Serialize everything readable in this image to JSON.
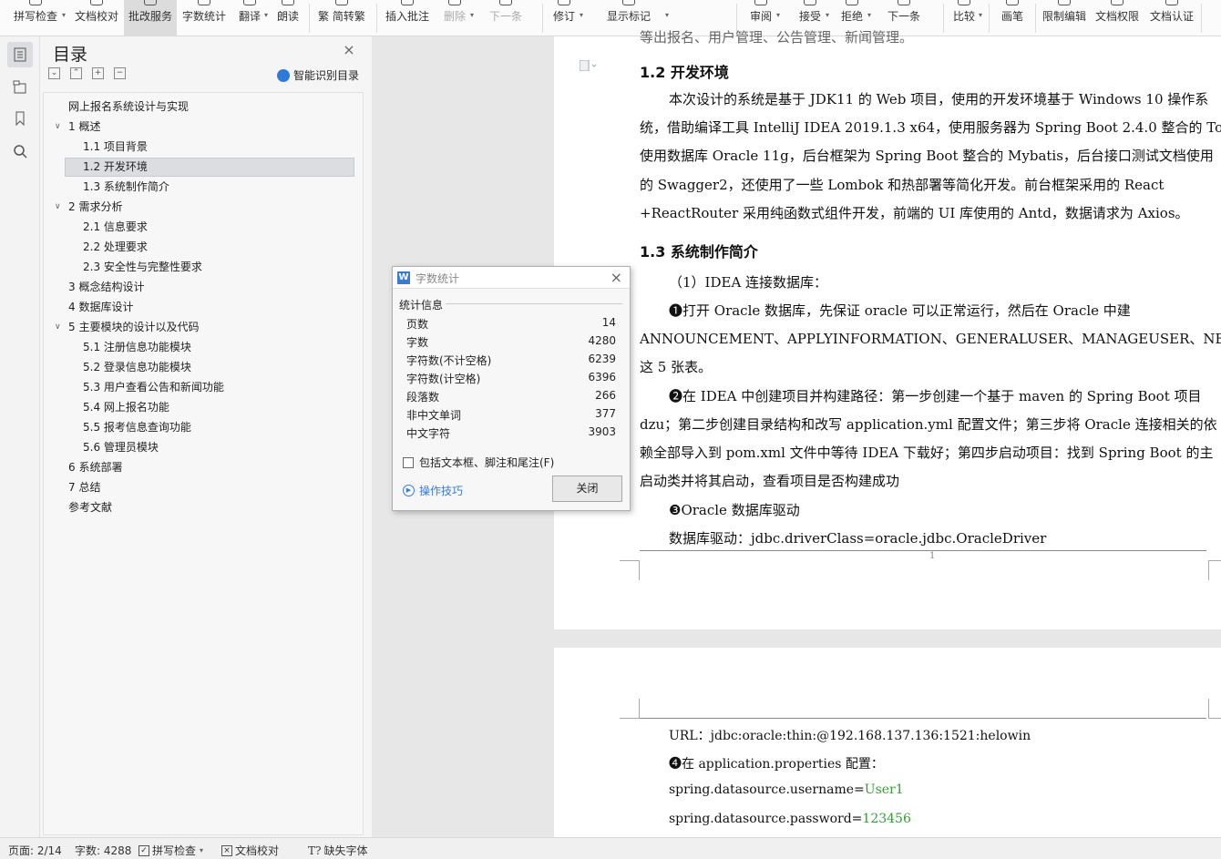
{
  "ribbon": {
    "items": [
      {
        "label": "拼写检查",
        "dropdown": true
      },
      {
        "label": "文档校对",
        "dropdown": false
      },
      {
        "label": "批改服务",
        "dropdown": false
      },
      {
        "label": "字数统计",
        "dropdown": false
      },
      {
        "label": "翻译",
        "dropdown": true
      },
      {
        "label": "朗读",
        "dropdown": false
      },
      {
        "label": "繁 简转繁",
        "dropdown": false
      },
      {
        "label": "插入批注",
        "dropdown": false
      },
      {
        "label": "删除",
        "dropdown": true
      },
      {
        "label": "下一条",
        "dropdown": false
      },
      {
        "label": "修订",
        "dropdown": true
      },
      {
        "label": "显示标记",
        "dropdown": true
      },
      {
        "label": "审阅",
        "dropdown": true
      },
      {
        "label": "接受",
        "dropdown": true
      },
      {
        "label": "拒绝",
        "dropdown": true
      },
      {
        "label": "下一条",
        "dropdown": false
      },
      {
        "label": "比较",
        "dropdown": true
      },
      {
        "label": "画笔",
        "dropdown": false
      },
      {
        "label": "限制编辑",
        "dropdown": false
      },
      {
        "label": "文档权限",
        "dropdown": false
      },
      {
        "label": "文档认证",
        "dropdown": false
      }
    ]
  },
  "toc": {
    "title": "目录",
    "smart_label": "智能识别目录",
    "items": [
      {
        "text": "网上报名系统设计与实现",
        "level": 0,
        "arrow": ""
      },
      {
        "text": "1  概述",
        "level": 1,
        "arrow": "v"
      },
      {
        "text": "1.1  项目背景",
        "level": 2,
        "arrow": ""
      },
      {
        "text": "1.2  开发环境",
        "level": 2,
        "arrow": "",
        "active": true
      },
      {
        "text": "1.3  系统制作简介",
        "level": 2,
        "arrow": ""
      },
      {
        "text": "2  需求分析",
        "level": 1,
        "arrow": "v"
      },
      {
        "text": "2.1  信息要求",
        "level": 2,
        "arrow": ""
      },
      {
        "text": "2.2  处理要求",
        "level": 2,
        "arrow": ""
      },
      {
        "text": "2.3  安全性与完整性要求",
        "level": 2,
        "arrow": ""
      },
      {
        "text": "3  概念结构设计",
        "level": 1,
        "arrow": ""
      },
      {
        "text": "4  数据库设计",
        "level": 1,
        "arrow": ""
      },
      {
        "text": "5  主要模块的设计以及代码",
        "level": 1,
        "arrow": "v"
      },
      {
        "text": "5.1  注册信息功能模块",
        "level": 2,
        "arrow": ""
      },
      {
        "text": "5.2  登录信息功能模块",
        "level": 2,
        "arrow": ""
      },
      {
        "text": "5.3  用户查看公告和新闻功能",
        "level": 2,
        "arrow": ""
      },
      {
        "text": "5.4  网上报名功能",
        "level": 2,
        "arrow": ""
      },
      {
        "text": "5.5  报考信息查询功能",
        "level": 2,
        "arrow": ""
      },
      {
        "text": "5.6  管理员模块",
        "level": 2,
        "arrow": ""
      },
      {
        "text": "6  系统部署",
        "level": 1,
        "arrow": ""
      },
      {
        "text": "7  总结",
        "level": 1,
        "arrow": ""
      },
      {
        "text": "参考文献",
        "level": 0,
        "arrow": ""
      }
    ]
  },
  "document": {
    "top_partial": "等出报名、用户管理、公告管理、新闻管理。",
    "h12": "1.2  开发环境",
    "p_env": [
      "本次设计的系统是基于 JDK11 的 Web 项目，使用的开发环境基于 Windows 10 操作系",
      "统，借助编译工具 IntelliJ IDEA 2019.1.3 x64，使用服务器为 Spring Boot 2.4.0 整合的 Tomcat，",
      "使用数据库 Oracle 11g，后台框架为 Spring Boot 整合的 Mybatis，后台接口测试文档使用",
      "的 Swagger2，还使用了一些 Lombok 和热部署等简化开发。前台框架采用的 React",
      "+ReactRouter 采用纯函数式组件开发，前端的 UI 库使用的 Antd，数据请求为 Axios。"
    ],
    "h13": "1.3  系统制作简介",
    "p_intro": [
      "（1）IDEA 连接数据库：",
      "❶打开 Oracle 数据库，先保证 oracle 可以正常运行，然后在 Oracle 中建",
      "ANNOUNCEMENT、APPLYINFORMATION、GENERALUSER、MANAGEUSER、NEWS",
      "这 5 张表。",
      "❷在 IDEA 中创建项目并构建路径：第一步创建一个基于 maven 的 Spring Boot 项目",
      "dzu；第二步创建目录结构和改写 application.yml 配置文件；第三步将 Oracle 连接相关的依",
      "赖全部导入到 pom.xml 文件中等待 IDEA 下载好；第四步启动项目：找到 Spring Boot 的主",
      "启动类并将其启动，查看项目是否构建成功",
      "❸Oracle 数据库驱动",
      "数据库驱动：jdbc.driverClass=oracle.jdbc.OracleDriver"
    ],
    "page_number": "1",
    "p2": {
      "url": "URL：jdbc:oracle:thin:@192.168.137.136:1521:helowin",
      "cfg": "❹在 application.properties 配置：",
      "user_key": "spring.datasource.username=",
      "user_val": "User1",
      "pass_key": "spring.datasource.password=",
      "pass_val": "123456"
    }
  },
  "dialog": {
    "title": "字数统计",
    "section": "统计信息",
    "stats": [
      {
        "label": "页数",
        "value": "14"
      },
      {
        "label": "字数",
        "value": "4280"
      },
      {
        "label": "字符数(不计空格)",
        "value": "6239"
      },
      {
        "label": "字符数(计空格)",
        "value": "6396"
      },
      {
        "label": "段落数",
        "value": "266"
      },
      {
        "label": "非中文单词",
        "value": "377"
      },
      {
        "label": "中文字符",
        "value": "3903"
      }
    ],
    "checkbox_label": "包括文本框、脚注和尾注(F)",
    "tips_label": "操作技巧",
    "close_label": "关闭"
  },
  "status": {
    "page": "页面: 2/14",
    "words": "字数: 4288",
    "spell": "拼写检查",
    "proof": "文档校对",
    "font_missing": "缺失字体"
  },
  "colors": {
    "accent": "#3b7bd6",
    "highlight": "#dbdde1",
    "green_text": "#3a9a3a"
  }
}
